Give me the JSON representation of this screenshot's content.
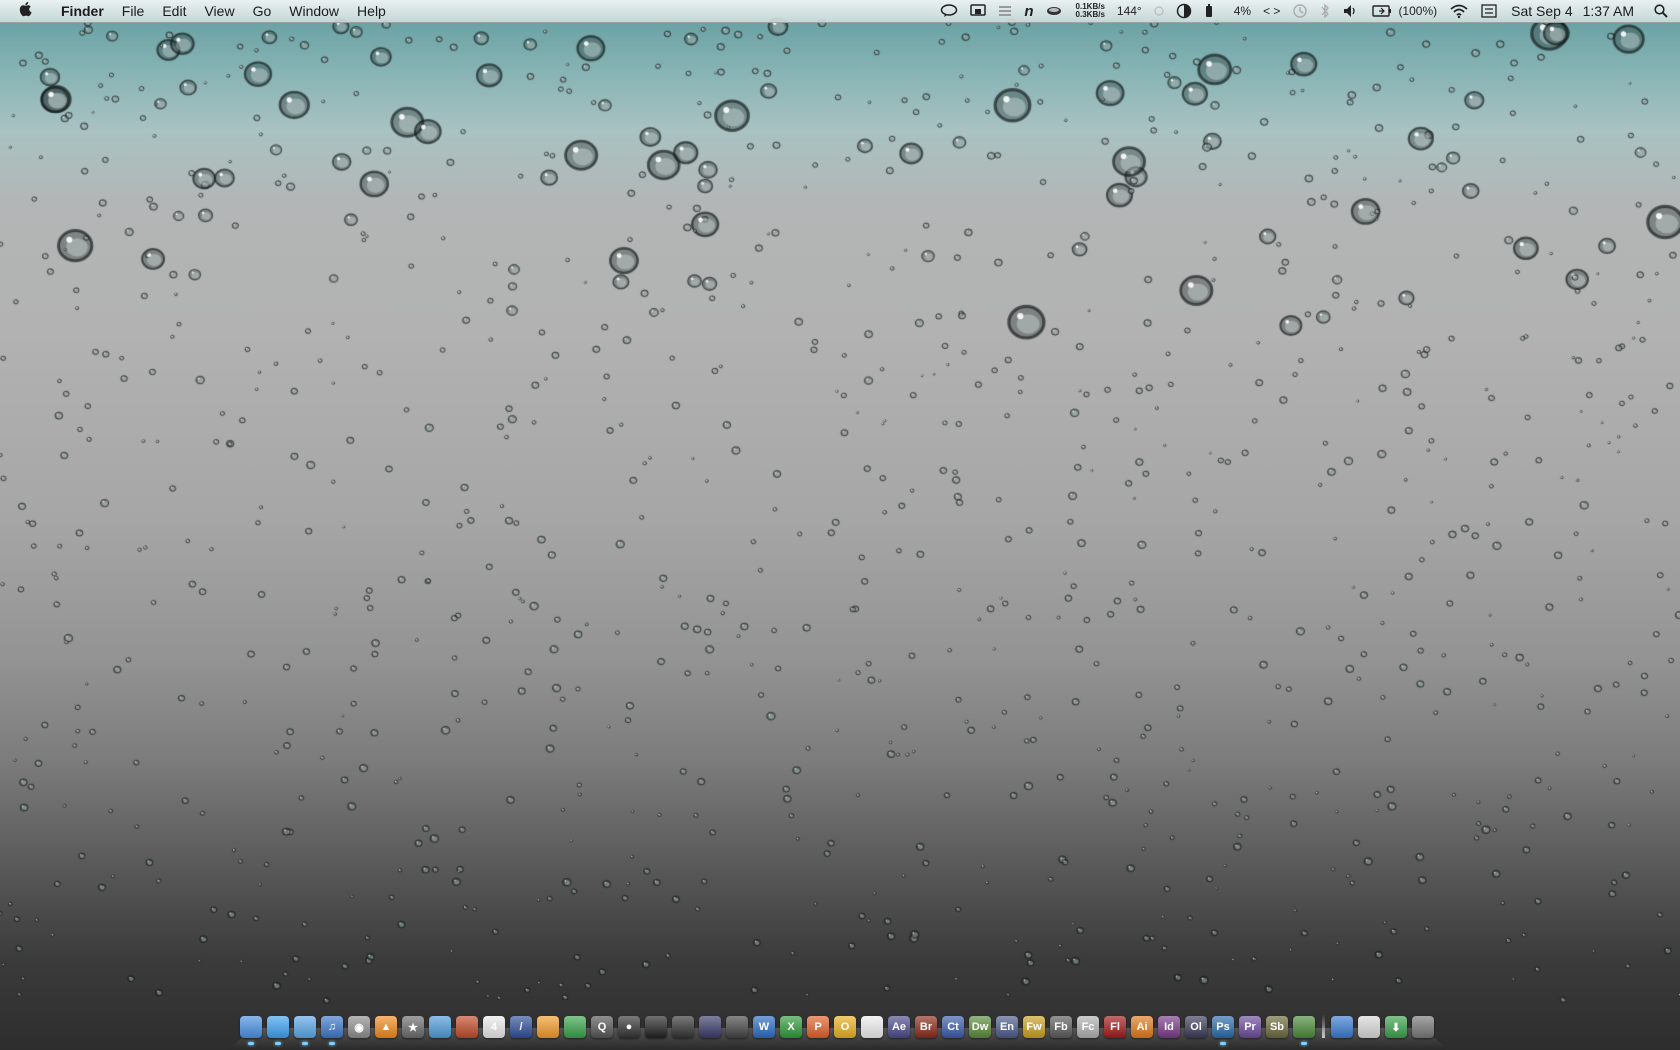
{
  "menubar": {
    "app_name": "Finder",
    "menus": [
      "File",
      "Edit",
      "View",
      "Go",
      "Window",
      "Help"
    ],
    "status": {
      "net_up": "0.1KB/s",
      "net_down": "0.3KB/s",
      "temperature": "144°",
      "cpu": "4%",
      "code_icon_text": "< >",
      "battery": "(100%)",
      "date": "Sat Sep 4",
      "time": "1:37 AM"
    }
  },
  "dock": {
    "apps": [
      {
        "name": "finder-icon",
        "label": "",
        "color": "#4a8fe0",
        "running": true
      },
      {
        "name": "messages-icon",
        "label": "",
        "color": "#3fa0f0",
        "running": true
      },
      {
        "name": "safari-icon",
        "label": "",
        "color": "#5aa6e6",
        "running": true
      },
      {
        "name": "itunes-icon",
        "label": "♫",
        "color": "#3c78c8",
        "running": true
      },
      {
        "name": "dvd-player-icon",
        "label": "◉",
        "color": "#8d8d8d",
        "running": false
      },
      {
        "name": "vlc-icon",
        "label": "▲",
        "color": "#f08a1e",
        "running": false
      },
      {
        "name": "imovie-icon",
        "label": "★",
        "color": "#6b6b6b",
        "running": false
      },
      {
        "name": "iphoto-icon",
        "label": "",
        "color": "#4f9ad8",
        "running": false
      },
      {
        "name": "photo-booth-icon",
        "label": "",
        "color": "#c04a2a",
        "running": false
      },
      {
        "name": "ical-icon",
        "label": "4",
        "color": "#e9e9e9",
        "running": false
      },
      {
        "name": "pen-icon",
        "label": "/",
        "color": "#2f4f9a",
        "running": false
      },
      {
        "name": "pages-icon",
        "label": "",
        "color": "#f09a2a",
        "running": false
      },
      {
        "name": "numbers-icon",
        "label": "",
        "color": "#3aa24a",
        "running": false
      },
      {
        "name": "quicktime-icon",
        "label": "Q",
        "color": "#555",
        "running": false
      },
      {
        "name": "camera-icon",
        "label": "●",
        "color": "#333",
        "running": false
      },
      {
        "name": "clapper-icon",
        "label": "",
        "color": "#222",
        "running": false
      },
      {
        "name": "final-cut-icon",
        "label": "",
        "color": "#333",
        "running": false
      },
      {
        "name": "frame-icon",
        "label": "",
        "color": "#3a3a6a",
        "running": false
      },
      {
        "name": "globe-icon",
        "label": "",
        "color": "#444",
        "running": false
      },
      {
        "name": "word-icon",
        "label": "W",
        "color": "#2b6bc4",
        "running": false
      },
      {
        "name": "excel-icon",
        "label": "X",
        "color": "#2f9a3a",
        "running": false
      },
      {
        "name": "powerpoint-icon",
        "label": "P",
        "color": "#e0602a",
        "running": false
      },
      {
        "name": "outlook-icon",
        "label": "O",
        "color": "#e8b020",
        "running": false
      },
      {
        "name": "acrobat-icon",
        "label": "",
        "color": "#eeeeee",
        "running": false
      },
      {
        "name": "after-effects-icon",
        "label": "Ae",
        "color": "#4b4a8a",
        "running": false
      },
      {
        "name": "bridge-icon",
        "label": "Br",
        "color": "#8a2a1a",
        "running": false
      },
      {
        "name": "contribute-icon",
        "label": "Ct",
        "color": "#3a5aaa",
        "running": false
      },
      {
        "name": "dreamweaver-icon",
        "label": "Dw",
        "color": "#5a8a3a",
        "running": false
      },
      {
        "name": "encore-icon",
        "label": "En",
        "color": "#4a5a8a",
        "running": false
      },
      {
        "name": "fireworks-icon",
        "label": "Fw",
        "color": "#c8a020",
        "running": false
      },
      {
        "name": "flash-builder-icon",
        "label": "Fb",
        "color": "#5a5a5a",
        "running": false
      },
      {
        "name": "flash-catalyst-icon",
        "label": "Fc",
        "color": "#b0b0b0",
        "running": false
      },
      {
        "name": "flash-icon",
        "label": "Fl",
        "color": "#a01a1a",
        "running": false
      },
      {
        "name": "illustrator-icon",
        "label": "Ai",
        "color": "#e07a1a",
        "running": false
      },
      {
        "name": "indesign-icon",
        "label": "Id",
        "color": "#7a3a8a",
        "running": false
      },
      {
        "name": "onlocation-icon",
        "label": "Ol",
        "color": "#3a3a5a",
        "running": false
      },
      {
        "name": "photoshop-icon",
        "label": "Ps",
        "color": "#2a6aaa",
        "running": true
      },
      {
        "name": "premiere-icon",
        "label": "Pr",
        "color": "#6a4a9a",
        "running": false
      },
      {
        "name": "soundbooth-icon",
        "label": "Sb",
        "color": "#6a6a3a",
        "running": false
      },
      {
        "name": "photo-app-icon",
        "label": "",
        "color": "#4a8a3a",
        "running": true
      }
    ],
    "stack_items": [
      {
        "name": "applications-folder-icon",
        "label": "",
        "color": "#3a7ad0"
      },
      {
        "name": "documents-folder-icon",
        "label": "",
        "color": "#d8d8d8"
      },
      {
        "name": "downloads-folder-icon",
        "label": "⬇",
        "color": "#3aa04a"
      },
      {
        "name": "trash-icon",
        "label": "",
        "color": "#777"
      }
    ]
  }
}
